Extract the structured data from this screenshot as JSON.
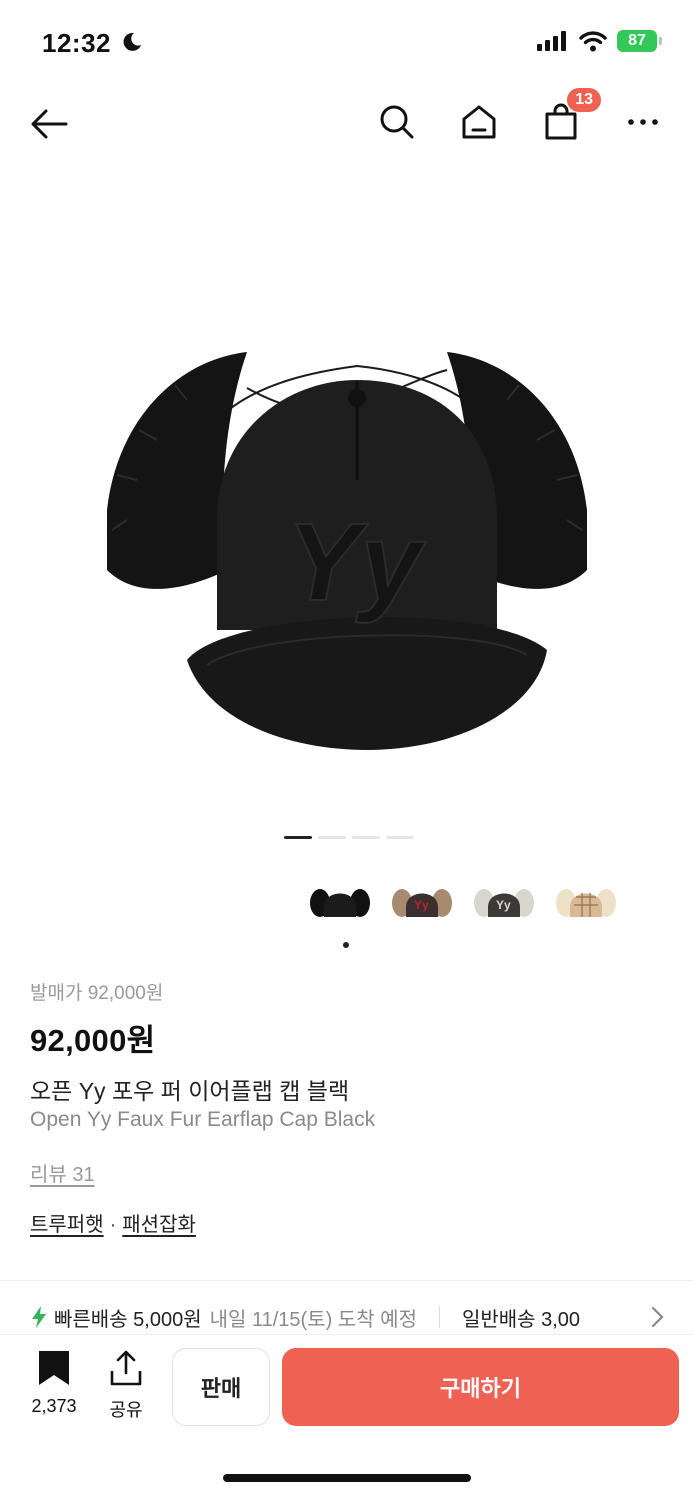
{
  "status_bar": {
    "time": "12:32",
    "battery": "87"
  },
  "nav": {
    "cart_badge": "13"
  },
  "gallery": {
    "page_count": 4,
    "active_page": 1
  },
  "thumbnails": [
    {
      "name": "black"
    },
    {
      "name": "brown-red-logo"
    },
    {
      "name": "grey-black"
    },
    {
      "name": "beige-plaid"
    }
  ],
  "product": {
    "release_price_label": "발매가 92,000원",
    "price": "92,000원",
    "title_ko": "오픈 Yy 포우 퍼 이어플랩 캡 블랙",
    "title_en": "Open Yy Faux Fur Earflap Cap Black",
    "reviews": "리뷰 31",
    "tags": [
      "트루퍼햇",
      "패션잡화"
    ],
    "tag_separator": "·"
  },
  "shipping": {
    "fast_label": "빠른배송 5,000원",
    "fast_date": "내일 11/15(토) 도착 예정",
    "normal_label": "일반배송 3,00"
  },
  "bottom_bar": {
    "saved_count": "2,373",
    "share_label": "공유",
    "sell_label": "판매",
    "buy_label": "구매하기"
  },
  "colors": {
    "accent": "#ef6253",
    "battery": "#34c759",
    "bolt": "#31b45a"
  }
}
